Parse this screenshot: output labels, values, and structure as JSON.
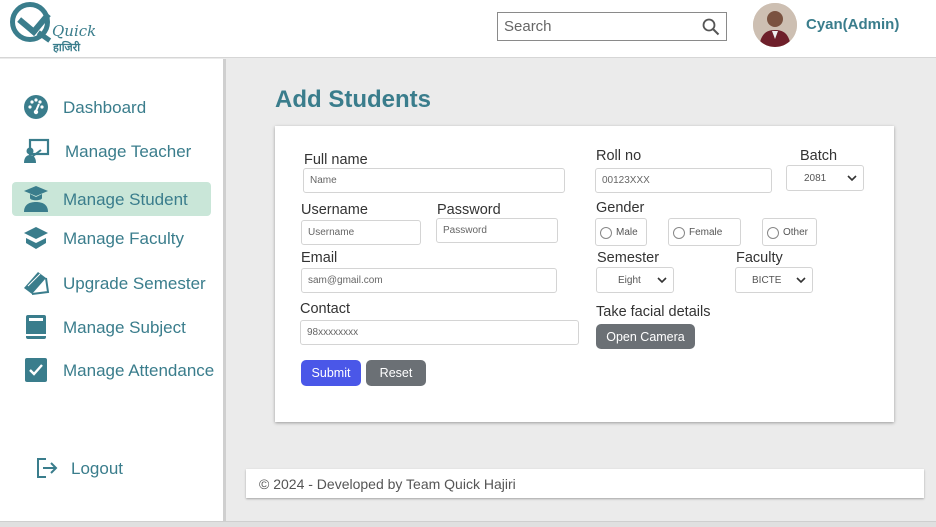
{
  "brand": {
    "logo_text": "Quick",
    "logo_subtext": "हाजिरी"
  },
  "header": {
    "search_placeholder": "Search",
    "user_name": "Cyan(Admin)"
  },
  "sidebar": {
    "items": [
      {
        "label": "Dashboard",
        "icon": "dashboard-gauge-icon",
        "active": false
      },
      {
        "label": "Manage Teacher",
        "icon": "teacher-board-icon",
        "active": false
      },
      {
        "label": "Manage Student",
        "icon": "student-graduate-icon",
        "active": true
      },
      {
        "label": "Manage Faculty",
        "icon": "faculty-cap-icon",
        "active": false
      },
      {
        "label": "Upgrade Semester",
        "icon": "semester-book-icon",
        "active": false
      },
      {
        "label": "Manage Subject",
        "icon": "subject-book-icon",
        "active": false
      },
      {
        "label": "Manage Attendance",
        "icon": "attendance-check-icon",
        "active": false
      }
    ],
    "logout_label": "Logout"
  },
  "page": {
    "title": "Add Students"
  },
  "form": {
    "full_name": {
      "label": "Full name",
      "placeholder": "Name"
    },
    "username": {
      "label": "Username",
      "placeholder": "Username"
    },
    "password": {
      "label": "Password",
      "placeholder": "Password"
    },
    "email": {
      "label": "Email",
      "placeholder": "sam@gmail.com"
    },
    "contact": {
      "label": "Contact",
      "placeholder": "98xxxxxxxx"
    },
    "roll_no": {
      "label": "Roll no",
      "placeholder": "00123XXX"
    },
    "batch": {
      "label": "Batch",
      "value": "2081"
    },
    "gender": {
      "label": "Gender",
      "options": [
        "Male",
        "Female",
        "Other"
      ]
    },
    "semester": {
      "label": "Semester",
      "value": "Eight"
    },
    "faculty": {
      "label": "Faculty",
      "value": "BICTE"
    },
    "facial": {
      "label": "Take facial details",
      "button": "Open Camera"
    },
    "submit_label": "Submit",
    "reset_label": "Reset"
  },
  "footer": {
    "text": "© 2024 - Developed by Team Quick Hajiri"
  },
  "colors": {
    "accent": "#3a7d8c",
    "active_bg": "#c9e6d8",
    "submit": "#4a57e8",
    "secondary": "#6b7075"
  }
}
